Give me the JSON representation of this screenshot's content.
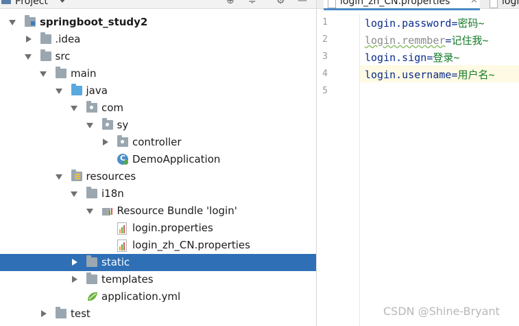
{
  "project_pane": {
    "title": "Project"
  },
  "tree": [
    {
      "label": "springboot_study2",
      "indent": 0,
      "arrow": "down",
      "icon": "module-folder-icon",
      "bold": true
    },
    {
      "label": ".idea",
      "indent": 1,
      "arrow": "right",
      "icon": "folder-icon"
    },
    {
      "label": "src",
      "indent": 1,
      "arrow": "down",
      "icon": "folder-icon"
    },
    {
      "label": "main",
      "indent": 2,
      "arrow": "down",
      "icon": "folder-icon"
    },
    {
      "label": "java",
      "indent": 3,
      "arrow": "down",
      "icon": "source-folder-icon"
    },
    {
      "label": "com",
      "indent": 4,
      "arrow": "down",
      "icon": "package-icon"
    },
    {
      "label": "sy",
      "indent": 5,
      "arrow": "down",
      "icon": "package-icon"
    },
    {
      "label": "controller",
      "indent": 6,
      "arrow": "right",
      "icon": "package-icon"
    },
    {
      "label": "DemoApplication",
      "indent": 6,
      "arrow": "none",
      "icon": "spring-class-icon"
    },
    {
      "label": "resources",
      "indent": 3,
      "arrow": "down",
      "icon": "resources-folder-icon"
    },
    {
      "label": "i18n",
      "indent": 4,
      "arrow": "down",
      "icon": "folder-icon"
    },
    {
      "label": "Resource Bundle 'login'",
      "indent": 5,
      "arrow": "down",
      "icon": "resource-bundle-icon"
    },
    {
      "label": "login.properties",
      "indent": 6,
      "arrow": "none",
      "icon": "properties-file-icon"
    },
    {
      "label": "login_zh_CN.properties",
      "indent": 6,
      "arrow": "none",
      "icon": "properties-file-icon"
    },
    {
      "label": "static",
      "indent": 4,
      "arrow": "right",
      "icon": "folder-icon",
      "selected": true
    },
    {
      "label": "templates",
      "indent": 4,
      "arrow": "right",
      "icon": "folder-icon"
    },
    {
      "label": "application.yml",
      "indent": 4,
      "arrow": "none",
      "icon": "yaml-file-icon"
    },
    {
      "label": "test",
      "indent": 2,
      "arrow": "right",
      "icon": "folder-icon"
    }
  ],
  "editor": {
    "tabs": [
      {
        "label": "login_zh_CN.properties",
        "active": true,
        "close": "×"
      },
      {
        "label": "logi",
        "active": false
      }
    ],
    "lines": [
      {
        "num": "1",
        "key": "login.password",
        "eq": "=",
        "value": "密码~",
        "dim": false,
        "typo": false
      },
      {
        "num": "2",
        "key": "login.remmber",
        "eq": "=",
        "value": "记住我~",
        "dim": true,
        "typo": true
      },
      {
        "num": "3",
        "key": "login.sign",
        "eq": "=",
        "value": "登录~",
        "dim": false,
        "typo": false
      },
      {
        "num": "4",
        "key": "login.username",
        "eq": "=",
        "value": "用户名~",
        "dim": false,
        "typo": false,
        "current": true
      },
      {
        "num": "5",
        "key": "",
        "eq": "",
        "value": "",
        "dim": false,
        "typo": false
      }
    ]
  },
  "watermark": "CSDN @Shine-Bryant",
  "colors": {
    "selection": "#2e6fb6",
    "key": "#0a2a8c",
    "value": "#127a27",
    "current_line": "#fffae3"
  }
}
